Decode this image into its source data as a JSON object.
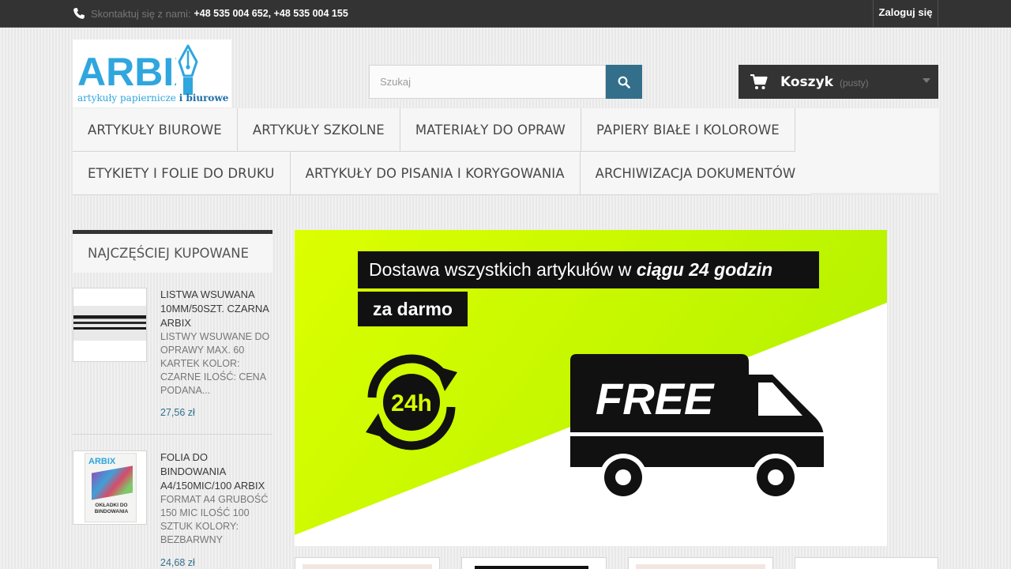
{
  "topbar": {
    "contact_label": "Skontaktuj się z nami:",
    "phones": "+48 535 004 652, +48 535 004 155",
    "login_label": "Zaloguj się"
  },
  "logo": {
    "text": "ARBIX",
    "tagline_regular": "artykuły papiernicze ",
    "tagline_bold": "i biurowe"
  },
  "search": {
    "placeholder": "Szukaj"
  },
  "cart": {
    "label": "Koszyk",
    "status": "(pusty)"
  },
  "menu": {
    "row1": [
      "Artykuły biurowe",
      "Artykuły szkolne",
      "Materiały do opraw",
      "Papiery białe i kolorowe"
    ],
    "row2": [
      "Etykiety i folie do druku",
      "Artykuły do pisania i korygowania",
      "Archiwizacja dokumentów"
    ]
  },
  "sidebar": {
    "title": "Najczęściej kupowane",
    "products": [
      {
        "name": "Listwa wsuwana 10mm/50szt. czarna ARBIX",
        "description": "LISTWY WSUWANE DO OPRAWY MAX. 60 KARTEK KOLOR: CZARNE ILOŚĆ: CENA PODANA...",
        "price": "27,56 zł"
      },
      {
        "name": "Folia do bindowania A4/150mic/100 ARBIX",
        "description": "FORMAT A4 GRUBOŚĆ 150 MIC ILOŚĆ 100 SZTUK KOLORY: BEZBARWNY",
        "price": "24,68 zł",
        "thumb_brand": "ARBIX",
        "thumb_caption": "OKŁADKI DO BINDOWANIA"
      }
    ]
  },
  "banner": {
    "line1_regular": "Dostawa wszystkich artykułów w ",
    "line1_bold": "ciągu 24 godzin",
    "line2": "za darmo",
    "badge": "24h",
    "truck_text": "FREE"
  },
  "colors": {
    "topbar": "#333333",
    "accent": "#336f8a",
    "logo_blue": "#2fa6de",
    "banner_lime": "#c8f500"
  }
}
